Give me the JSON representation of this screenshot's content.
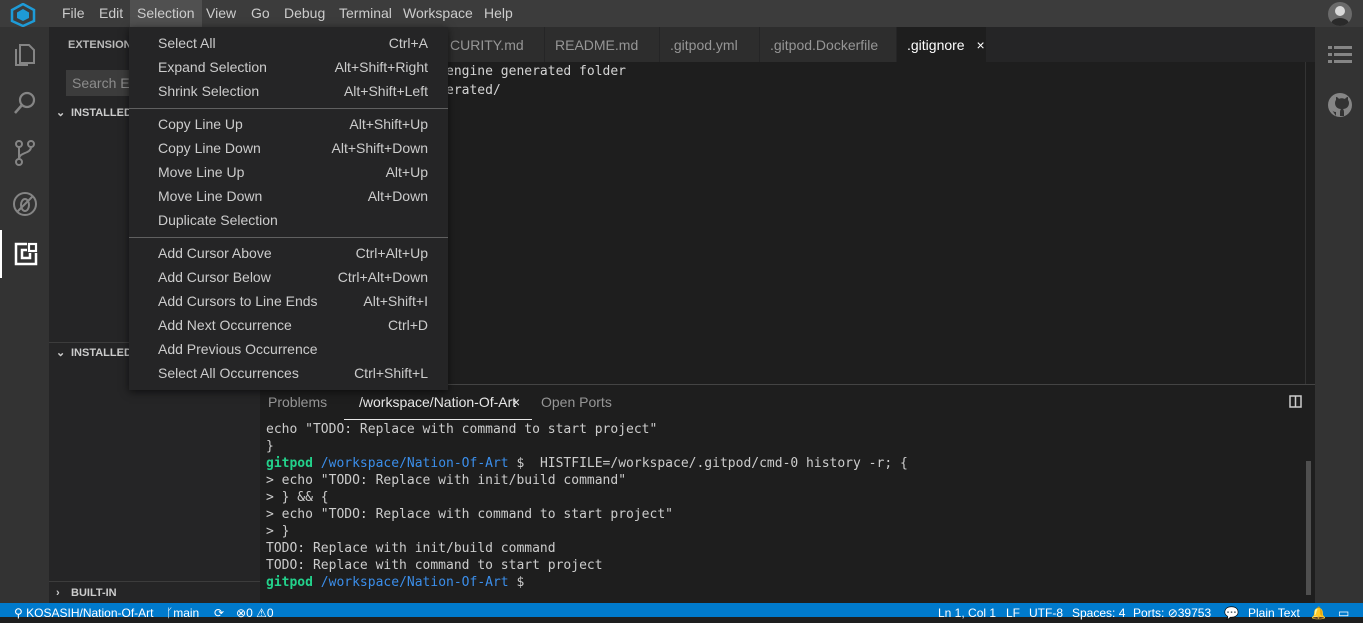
{
  "menubar": {
    "items": [
      "File",
      "Edit",
      "Selection",
      "View",
      "Go",
      "Debug",
      "Terminal",
      "Workspace",
      "Help"
    ]
  },
  "sidebar": {
    "title": "EXTENSION",
    "search_placeholder": "Search Ex",
    "sections": [
      "INSTALLED",
      "INSTALLED",
      "BUILT-IN"
    ]
  },
  "tabs": [
    {
      "label": "CURITY.md"
    },
    {
      "label": "README.md"
    },
    {
      "label": ".gitpod.yml"
    },
    {
      "label": ".gitpod.Dockerfile"
    },
    {
      "label": ".gitignore",
      "close": "×"
    }
  ],
  "editor": {
    "lines": [
      "engine generated folder",
      "erated/"
    ]
  },
  "selection_menu": {
    "groups": [
      [
        {
          "label": "Select All",
          "shortcut": "Ctrl+A"
        },
        {
          "label": "Expand Selection",
          "shortcut": "Alt+Shift+Right"
        },
        {
          "label": "Shrink Selection",
          "shortcut": "Alt+Shift+Left"
        }
      ],
      [
        {
          "label": "Copy Line Up",
          "shortcut": "Alt+Shift+Up"
        },
        {
          "label": "Copy Line Down",
          "shortcut": "Alt+Shift+Down"
        },
        {
          "label": "Move Line Up",
          "shortcut": "Alt+Up"
        },
        {
          "label": "Move Line Down",
          "shortcut": "Alt+Down"
        },
        {
          "label": "Duplicate Selection",
          "shortcut": ""
        }
      ],
      [
        {
          "label": "Add Cursor Above",
          "shortcut": "Ctrl+Alt+Up"
        },
        {
          "label": "Add Cursor Below",
          "shortcut": "Ctrl+Alt+Down"
        },
        {
          "label": "Add Cursors to Line Ends",
          "shortcut": "Alt+Shift+I"
        },
        {
          "label": "Add Next Occurrence",
          "shortcut": "Ctrl+D"
        },
        {
          "label": "Add Previous Occurrence",
          "shortcut": ""
        },
        {
          "label": "Select All Occurrences",
          "shortcut": "Ctrl+Shift+L"
        }
      ]
    ]
  },
  "panel": {
    "tabs": [
      {
        "label": "Problems"
      },
      {
        "label": "/workspace/Nation-Of-Art",
        "close": "×"
      },
      {
        "label": "Open Ports"
      }
    ]
  },
  "terminal": {
    "lines": [
      {
        "text": "echo \"TODO: Replace with command to start project\""
      },
      {
        "text": "}"
      },
      {
        "user": "gitpod",
        "path": "/workspace/Nation-Of-Art",
        "cmd": " $  HISTFILE=/workspace/.gitpod/cmd-0 history -r; {"
      },
      {
        "text": "> echo \"TODO: Replace with init/build command\""
      },
      {
        "text": "> } && {"
      },
      {
        "text": "> echo \"TODO: Replace with command to start project\""
      },
      {
        "text": "> }"
      },
      {
        "text": "TODO: Replace with init/build command"
      },
      {
        "text": "TODO: Replace with command to start project"
      },
      {
        "user": "gitpod",
        "path": "/workspace/Nation-Of-Art",
        "cmd": " $ "
      }
    ]
  },
  "statusbar": {
    "repo": "KOSASIH/Nation-Of-Art",
    "branch": "main",
    "errors": "0",
    "warnings": "0",
    "position": "Ln 1, Col 1",
    "eol": "LF",
    "encoding": "UTF-8",
    "spaces": "Spaces: 4",
    "ports_label": "Ports:",
    "ports_value": "39753",
    "language": "Plain Text"
  },
  "colors": {
    "accent": "#007acc",
    "terminal_user": "#23d18b",
    "terminal_path": "#3b8eea"
  }
}
